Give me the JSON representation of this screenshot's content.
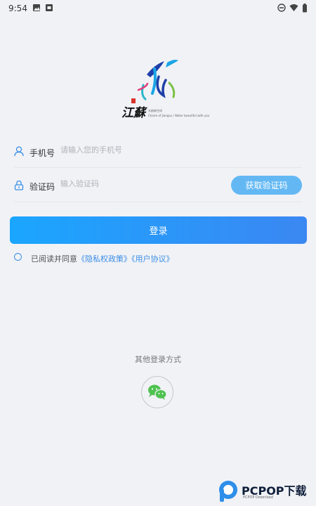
{
  "status_bar": {
    "time": "9:54"
  },
  "logo": {
    "brand_text": "江蘇",
    "subtitle_cn": "水韵新空间",
    "subtitle_en": "Charm of Jiangsu / Water beautiful with you"
  },
  "form": {
    "phone": {
      "label": "手机号",
      "placeholder": "请输入您的手机号"
    },
    "code": {
      "label": "验证码",
      "placeholder": "输入验证码",
      "get_code_label": "获取验证码"
    },
    "login_label": "登录"
  },
  "agreement": {
    "prefix": "已阅读并同意",
    "privacy_link": "《隐私权政策》",
    "user_link": "《用户协议》"
  },
  "other_login": {
    "title": "其他登录方式",
    "wechat_icon": "wechat-icon"
  },
  "watermark": {
    "name": "PCPOP下载",
    "sub": "PCPOP Download"
  },
  "colors": {
    "accent": "#3a8ee6",
    "button_start": "#1aa6ff",
    "button_end": "#3b87f2",
    "code_button": "#63b8f4",
    "wechat": "#4fc24f"
  }
}
